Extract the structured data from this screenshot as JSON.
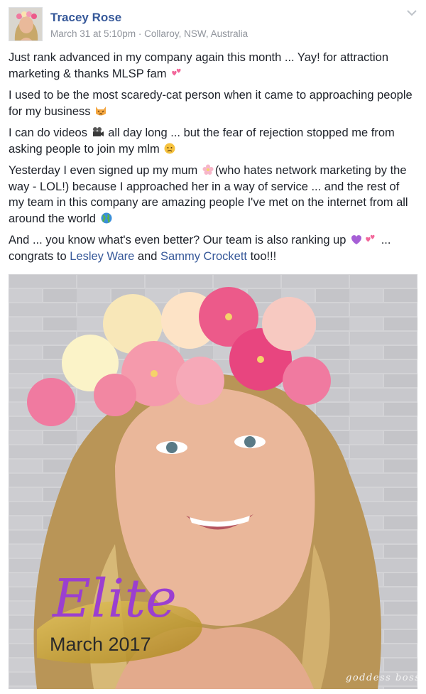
{
  "post": {
    "author": "Tracey Rose",
    "date": "March 31 at 5:10pm",
    "separator": " · ",
    "location": "Collaroy, NSW, Australia",
    "paragraphs": {
      "p1": "Just rank advanced in my company again this month ... Yay! for attraction marketing & thanks MLSP fam",
      "p2": "I used to be the most scaredy-cat person when it came to approaching people for my business",
      "p3a": "I can do videos",
      "p3b": "all day long ... but the fear of rejection stopped me from asking people to join my mlm",
      "p4a": "Yesterday I even signed up my mum",
      "p4b": "(who hates network marketing by the way - LOL!) because I approached her in a way of service ... and the rest of my team in this company are amazing people I've met on the internet from all around the world",
      "p5a": "And ... you know what's even better? Our team is also ranking up",
      "p5b": "... congrats to",
      "mention1": "Lesley Ware",
      "and": "and",
      "mention2": "Sammy Crockett",
      "p5c": "too!!!"
    },
    "emojis": [
      "two-hearts-icon",
      "weary-cat-icon",
      "movie-camera-icon",
      "worried-face-icon",
      "cherry-blossom-icon",
      "globe-icon",
      "purple-heart-icon",
      "two-hearts-icon"
    ]
  },
  "photo": {
    "overlay_title": "Elite",
    "overlay_subtitle": "March 2017",
    "watermark": "goddess boss"
  },
  "colors": {
    "link": "#365899",
    "meta": "#90949c",
    "elite_purple": "#9b3fd0",
    "gold": "#c9a227"
  }
}
